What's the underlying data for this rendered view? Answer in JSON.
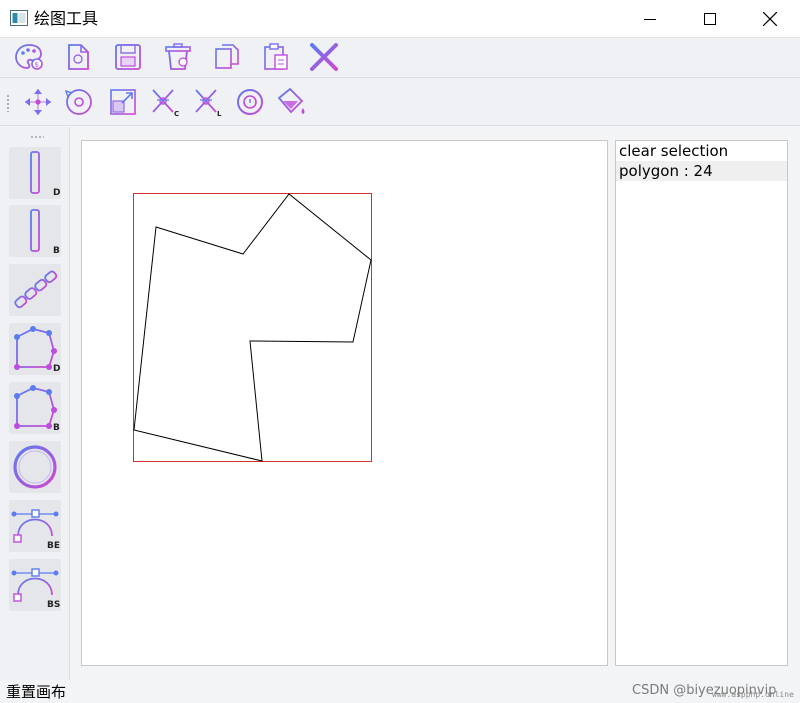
{
  "window": {
    "title": "绘图工具",
    "app_icon": "window-app-icon",
    "controls": [
      "minimize-icon",
      "maximize-icon",
      "close-icon"
    ]
  },
  "toolbar_top": {
    "items": [
      "palette-icon",
      "new-file-icon",
      "save-icon",
      "delete-icon",
      "copy-icon",
      "paste-icon",
      "cross-icon"
    ]
  },
  "toolbar_second": {
    "items": [
      "move-icon",
      "rotate-icon",
      "scale-icon",
      "cut-c-icon",
      "cut-l-icon",
      "circle-clip-icon",
      "fill-bucket-icon"
    ]
  },
  "sidebar": {
    "tools": [
      {
        "icon": "line-dda-icon",
        "label": "D"
      },
      {
        "icon": "line-bresenham-icon",
        "label": "B"
      },
      {
        "icon": "dashed-line-icon",
        "label": ""
      },
      {
        "icon": "polygon-dda-icon",
        "label": "D"
      },
      {
        "icon": "polygon-bresenham-icon",
        "label": "B"
      },
      {
        "icon": "ellipse-icon",
        "label": ""
      },
      {
        "icon": "curve-bezier-icon",
        "label": "BE"
      },
      {
        "icon": "curve-bspline-icon",
        "label": "BS"
      }
    ]
  },
  "canvas": {
    "selection_color": "#d32f2f",
    "polygon_stroke": "#000000"
  },
  "list_panel": {
    "items": [
      "clear selection",
      "polygon : 24"
    ]
  },
  "status": {
    "text": "重置画布"
  },
  "watermark": {
    "csdn": "CSDN @biyezuopinvip",
    "site": "www.aspphp.online"
  },
  "colors": {
    "icon_blue": "#5b7cf0",
    "icon_purple": "#c04be0",
    "icon_pink": "#d048d0"
  }
}
